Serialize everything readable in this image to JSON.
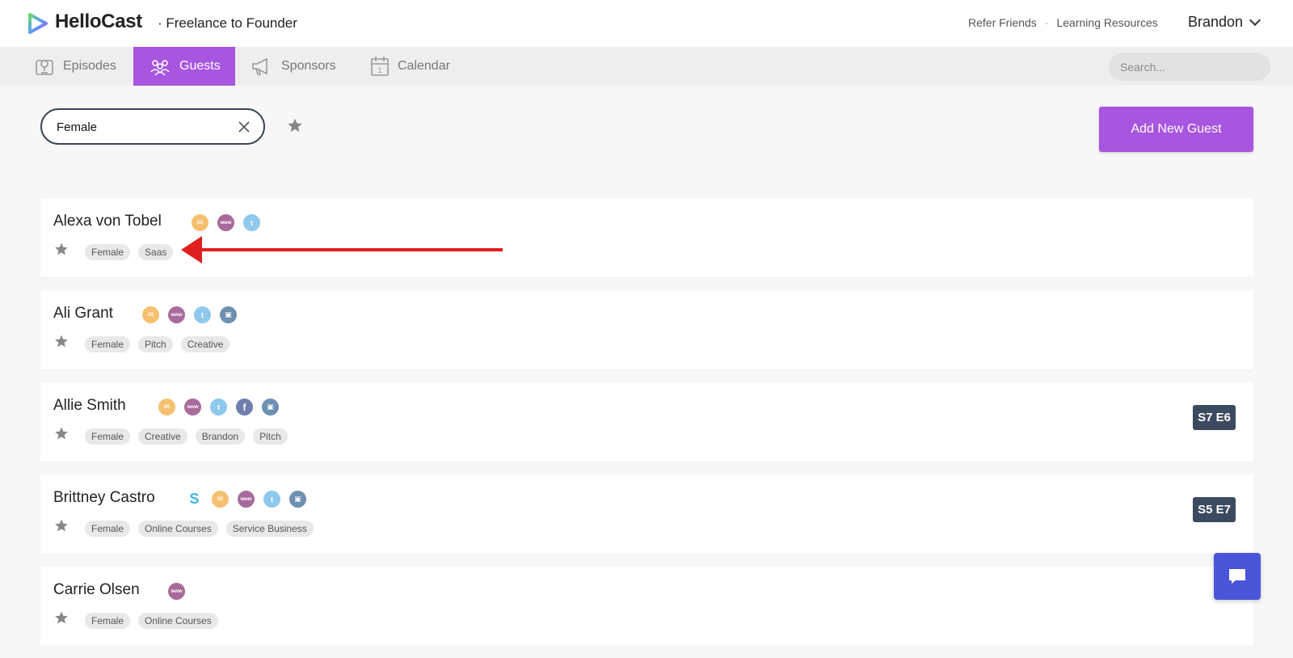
{
  "app": {
    "brand": "HelloCast",
    "podcast": "· Freelance to Founder"
  },
  "header": {
    "links": [
      "Refer Friends",
      "·",
      "Learning Resources"
    ],
    "user": "Brandon"
  },
  "nav": {
    "tabs": [
      {
        "label": "Episodes",
        "icon": "episodes-icon"
      },
      {
        "label": "Guests",
        "icon": "guests-icon",
        "active": true
      },
      {
        "label": "Sponsors",
        "icon": "megaphone-icon"
      },
      {
        "label": "Calendar",
        "icon": "calendar-icon"
      }
    ],
    "search_placeholder": "Search..."
  },
  "filter": {
    "value": "Female",
    "add_button": "Add New Guest"
  },
  "colors": {
    "accent": "#a855e0",
    "badge": "#3b4a5e",
    "chat": "#4b55d9",
    "arrow": "#e02020"
  },
  "guests": [
    {
      "name": "Alexa von Tobel",
      "contacts": [
        "email",
        "web",
        "twitter"
      ],
      "tags": [
        "Female",
        "Saas"
      ],
      "episode": ""
    },
    {
      "name": "Ali Grant",
      "contacts": [
        "email",
        "web",
        "twitter",
        "instagram"
      ],
      "tags": [
        "Female",
        "Pitch",
        "Creative"
      ],
      "episode": ""
    },
    {
      "name": "Allie Smith",
      "contacts": [
        "email",
        "web",
        "twitter",
        "facebook",
        "instagram"
      ],
      "tags": [
        "Female",
        "Creative",
        "Brandon",
        "Pitch"
      ],
      "episode": "S7 E6"
    },
    {
      "name": "Brittney Castro",
      "contacts": [
        "skype",
        "email",
        "web",
        "twitter",
        "instagram"
      ],
      "tags": [
        "Female",
        "Online Courses",
        "Service Business"
      ],
      "episode": "S5 E7"
    },
    {
      "name": "Carrie Olsen",
      "contacts": [
        "web"
      ],
      "tags": [
        "Female",
        "Online Courses"
      ],
      "episode": ""
    }
  ]
}
